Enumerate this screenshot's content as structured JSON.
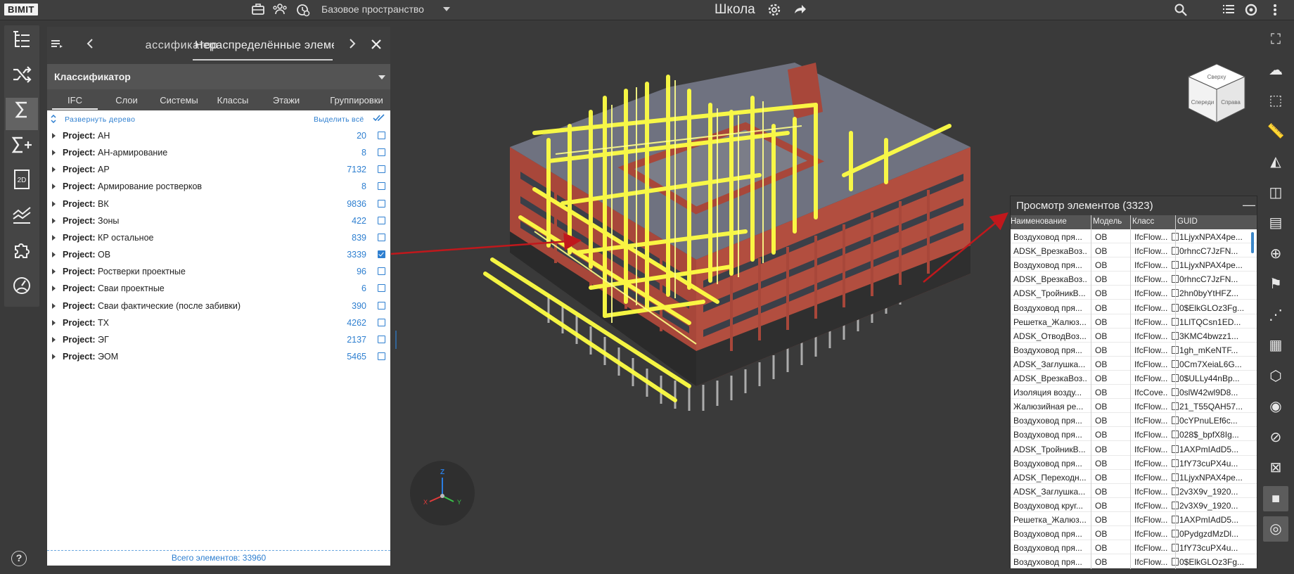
{
  "app": {
    "logo": "BIMIT",
    "title": "Школа"
  },
  "topbar": {
    "space_label": "Базовое пространство",
    "icons": [
      "briefcase-icon",
      "users-icon",
      "clock-shield-icon",
      "gear-icon",
      "share-icon",
      "search-icon",
      "list-icon",
      "sync-icon",
      "more-vertical-icon"
    ]
  },
  "left_toolbar": {
    "items": [
      {
        "name": "tree-icon",
        "glyph": "☷"
      },
      {
        "name": "shuffle-icon",
        "glyph": "⤨"
      },
      {
        "name": "sigma-icon",
        "glyph": "Σ",
        "active": true
      },
      {
        "name": "sigma-plus-icon",
        "glyph": "Σ+"
      },
      {
        "name": "2d-icon",
        "glyph": "2D"
      },
      {
        "name": "chart-icon",
        "glyph": "≈"
      },
      {
        "name": "puzzle-icon",
        "glyph": "✣"
      },
      {
        "name": "gauge-icon",
        "glyph": "◔"
      }
    ],
    "help": "?"
  },
  "panel": {
    "tabs": {
      "prev_tab": "ассификатор",
      "active_tab": "Нераспределённые элеме"
    },
    "classifier": {
      "title": "Классификатор",
      "subtabs": [
        "IFC",
        "Слои",
        "Системы",
        "Классы",
        "Этажи",
        "Группировки"
      ],
      "expand_label": "Развернуть дерево",
      "select_all_label": "Выделить всё",
      "items": [
        {
          "prefix": "Project:",
          "name": "АН",
          "count": "20",
          "checked": false
        },
        {
          "prefix": "Project:",
          "name": "АН-армирование",
          "count": "8",
          "checked": false
        },
        {
          "prefix": "Project:",
          "name": "АР",
          "count": "7132",
          "checked": false
        },
        {
          "prefix": "Project:",
          "name": "Армирование ростверков",
          "count": "8",
          "checked": false
        },
        {
          "prefix": "Project:",
          "name": "ВК",
          "count": "9836",
          "checked": false
        },
        {
          "prefix": "Project:",
          "name": "Зоны",
          "count": "422",
          "checked": false
        },
        {
          "prefix": "Project:",
          "name": "КР остальное",
          "count": "839",
          "checked": false
        },
        {
          "prefix": "Project:",
          "name": "ОВ",
          "count": "3339",
          "checked": true
        },
        {
          "prefix": "Project:",
          "name": "Ростверки проектные",
          "count": "96",
          "checked": false
        },
        {
          "prefix": "Project:",
          "name": "Сваи проектные",
          "count": "6",
          "checked": false
        },
        {
          "prefix": "Project:",
          "name": "Сваи фактические (после забивки)",
          "count": "390",
          "checked": false
        },
        {
          "prefix": "Project:",
          "name": "ТХ",
          "count": "4262",
          "checked": false
        },
        {
          "prefix": "Project:",
          "name": "ЭГ",
          "count": "2137",
          "checked": false
        },
        {
          "prefix": "Project:",
          "name": "ЭОМ",
          "count": "5465",
          "checked": false
        }
      ],
      "total_label": "Всего элементов: 33960"
    }
  },
  "viewcube": {
    "faces": [
      "Сверху",
      "Спереди",
      "Справа"
    ]
  },
  "axes": {
    "x": "X",
    "y": "Y",
    "z": "Z"
  },
  "right_toolbar": {
    "icons": [
      "focus-icon",
      "cloud-upload-icon",
      "fit-selection-icon",
      "ruler-icon",
      "section-plane-icon",
      "section-box-icon",
      "layers-icon",
      "target-icon",
      "flag-icon",
      "measure-points-icon",
      "grid-slice-icon",
      "cube-outline-icon",
      "eye-icon",
      "eye-off-icon",
      "clear-selection-icon",
      "solid-cube-icon",
      "orbit-icon"
    ]
  },
  "preview": {
    "title": "Просмотр элементов (3323)",
    "columns": [
      "Наименование",
      "Модель",
      "Класс",
      "GUID"
    ],
    "rows": [
      [
        "Воздуховод пря...",
        "ОВ",
        "IfcFlow...",
        "1LjyxNPAX4pe..."
      ],
      [
        "ADSK_ВрезкаВоз...",
        "ОВ",
        "IfcFlow...",
        "0rhncC7JzFN..."
      ],
      [
        "Воздуховод пря...",
        "ОВ",
        "IfcFlow...",
        "1LjyxNPAX4pe..."
      ],
      [
        "ADSK_ВрезкаВоз...",
        "ОВ",
        "IfcFlow...",
        "0rhncC7JzFN..."
      ],
      [
        "ADSK_ТройникВ...",
        "ОВ",
        "IfcFlow...",
        "2hn0byYtHFZ..."
      ],
      [
        "Воздуховод пря...",
        "ОВ",
        "IfcFlow...",
        "0$ElkGLOz3Fg..."
      ],
      [
        "Решетка_Жалюз...",
        "ОВ",
        "IfcFlow...",
        "1LlTQCsn1ED..."
      ],
      [
        "ADSK_ОтводВоз...",
        "ОВ",
        "IfcFlow...",
        "3KMC4bwzz1..."
      ],
      [
        "Воздуховод пря...",
        "ОВ",
        "IfcFlow...",
        "1gh_mKeNTF..."
      ],
      [
        "ADSK_Заглушка...",
        "ОВ",
        "IfcFlow...",
        "0Cm7XeiaL6G..."
      ],
      [
        "ADSK_ВрезкаВоз...",
        "ОВ",
        "IfcFlow...",
        "0$ULLy44nBp..."
      ],
      [
        "Изоляция возду...",
        "ОВ",
        "IfcCove...",
        "0slW42wl9D8..."
      ],
      [
        "Жалюзийная ре...",
        "ОВ",
        "IfcFlow...",
        "21_T55QAH57..."
      ],
      [
        "Воздуховод пря...",
        "ОВ",
        "IfcFlow...",
        "0cYPnuLEf6c..."
      ],
      [
        "Воздуховод пря...",
        "ОВ",
        "IfcFlow...",
        "028$_bpfX8Ig..."
      ],
      [
        "ADSK_ТройникВ...",
        "ОВ",
        "IfcFlow...",
        "1AXPmIAdD5..."
      ],
      [
        "Воздуховод пря...",
        "ОВ",
        "IfcFlow...",
        "1fY73cuPX4u..."
      ],
      [
        "ADSK_Переходн...",
        "ОВ",
        "IfcFlow...",
        "1LjyxNPAX4pe..."
      ],
      [
        "ADSK_Заглушка...",
        "ОВ",
        "IfcFlow...",
        "2v3X9v_1920..."
      ],
      [
        "Воздуховод круг...",
        "ОВ",
        "IfcFlow...",
        "2v3X9v_1920..."
      ],
      [
        "Решетка_Жалюз...",
        "ОВ",
        "IfcFlow...",
        "1AXPmIAdD5..."
      ],
      [
        "Воздуховод пря...",
        "ОВ",
        "IfcFlow...",
        "0PydgzdMzDl..."
      ],
      [
        "Воздуховод пря...",
        "ОВ",
        "IfcFlow...",
        "1fY73cuPX4u..."
      ],
      [
        "Воздуховод пря...",
        "ОВ",
        "IfcFlow...",
        "0$ElkGLOz3Fg..."
      ]
    ]
  },
  "colors": {
    "accent": "#2e7fd0",
    "highlight": "#ffff44",
    "brick": "#a8473a",
    "arrow": "#c0181c"
  }
}
